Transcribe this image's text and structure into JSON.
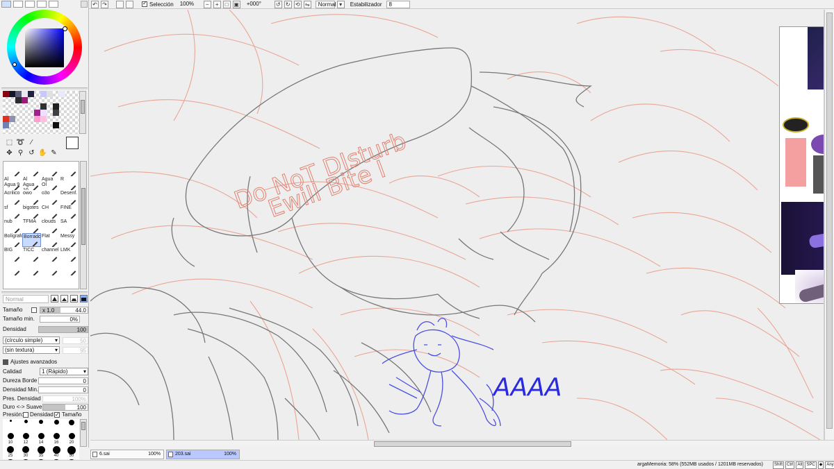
{
  "colors": {
    "accent": "#0000ff",
    "selection": "#c9dbff",
    "canvas_bg": "#eeeeee"
  },
  "toolbar": {
    "selection_label": "Selección",
    "zoom": "100%",
    "rotation": "+000°",
    "blend_mode": "Normal",
    "stabilizer_label": "Estabilizador",
    "stabilizer_value": "8"
  },
  "swatches": [
    "#8a0010",
    "#15152a",
    "#5c5c7a",
    "#e8e8f0",
    "#222240",
    "#ffffff",
    "#c8c8ff",
    "#e0e0e0",
    "#ffffff",
    "#e8e8ff",
    "#ffffff",
    "#ffffff",
    "#ffffff",
    "#ffffff",
    "#2a2a30",
    "#9e1a7a",
    "#ffffff",
    "#ffffff",
    "#ffffff",
    "#ffffff",
    "#ffffff",
    "#ffffff",
    "#ffffff",
    "#ffffff",
    "#ffffff",
    "#ffffff",
    "#ffffff",
    "#ffffff",
    "#ffffff",
    "#ffffff",
    "#303030",
    "#ffffff",
    "#202020",
    "#ffffff",
    "#ffffff",
    "#ffffff",
    "#ffffff",
    "#ffffff",
    "#ffffff",
    "#ffffff",
    "#ffffff",
    "#a02090",
    "#f0e0ff",
    "#ffffff",
    "#404040",
    "#ffffff",
    "#ffffff",
    "#ffffff",
    "#e03020",
    "#9090b0",
    "#ffffff",
    "#ffffff",
    "#ffffff",
    "#ffa0d0",
    "#ffc0e0",
    "#ffffff",
    "#ffffff",
    "#ffffff",
    "#ffffff",
    "#ffffff",
    "#7080b0",
    "#ffffff",
    "#ffffff",
    "#ffffff",
    "#ffffff",
    "#ffffff",
    "#ffffff",
    "#ffffff",
    "#101010",
    "#ffffff",
    "#ffffff",
    "#ffffff"
  ],
  "tools": [
    {
      "icon": "select-rect-icon",
      "glyph": "⬚"
    },
    {
      "icon": "lasso-icon",
      "glyph": "➰"
    },
    {
      "icon": "magic-wand-icon",
      "glyph": "⁄"
    },
    {
      "icon": "",
      "glyph": ""
    },
    {
      "icon": "",
      "glyph": ""
    },
    {
      "icon": "move-icon",
      "glyph": "✥"
    },
    {
      "icon": "zoom-icon",
      "glyph": "⚲"
    },
    {
      "icon": "rotate-icon",
      "glyph": "↺"
    },
    {
      "icon": "hand-icon",
      "glyph": "✋"
    },
    {
      "icon": "eyedropper-icon",
      "glyph": "✎"
    }
  ],
  "brushes": [
    {
      "label": "",
      "sel": false
    },
    {
      "label": "",
      "sel": false
    },
    {
      "label": "",
      "sel": false
    },
    {
      "label": "",
      "sel": false
    },
    {
      "label": "Al Agua 9",
      "sel": false
    },
    {
      "label": "Al Agua 10",
      "sel": false
    },
    {
      "label": "Agua Ol",
      "sel": false
    },
    {
      "label": "R",
      "sel": false
    },
    {
      "label": "Acrilico",
      "sel": false
    },
    {
      "label": "owo",
      "sel": false
    },
    {
      "label": "o3o",
      "sel": false
    },
    {
      "label": "Desenf.",
      "sel": false
    },
    {
      "label": "sf",
      "sel": false
    },
    {
      "label": "bigotes",
      "sel": false
    },
    {
      "label": "CH",
      "sel": false
    },
    {
      "label": "FINE",
      "sel": false
    },
    {
      "label": "nub",
      "sel": false
    },
    {
      "label": "TFMA",
      "sel": false
    },
    {
      "label": "clouds",
      "sel": false
    },
    {
      "label": "SA",
      "sel": false
    },
    {
      "label": "Bolígrafo",
      "sel": false
    },
    {
      "label": "Borrador",
      "sel": true
    },
    {
      "label": "Flat",
      "sel": false
    },
    {
      "label": "Messy",
      "sel": false
    },
    {
      "label": "BIG",
      "sel": false
    },
    {
      "label": "TICC",
      "sel": false
    },
    {
      "label": "channel",
      "sel": false
    },
    {
      "label": "LMK",
      "sel": false
    },
    {
      "label": "",
      "sel": false
    },
    {
      "label": "",
      "sel": false
    },
    {
      "label": "",
      "sel": false
    },
    {
      "label": "",
      "sel": false
    }
  ],
  "brush_props": {
    "blend": "Normal",
    "size_label": "Tamaño",
    "size_mult": "x 1.0",
    "size_value": "44.0",
    "min_size_label": "Tamaño min.",
    "min_size_value": "0%",
    "density_label": "Densidad",
    "density_value": "100",
    "shape": "(círculo simple)",
    "shape_value": "50",
    "texture": "(sin textura)",
    "texture_value": "95",
    "advanced_label": "Ajustes avanzados",
    "quality_label": "Calidad",
    "quality_value": "1 (Rápido)",
    "edge_label": "Dureza Borde",
    "edge_value": "0",
    "min_density_label": "Densidad Min.",
    "min_density_value": "0",
    "press_density_label": "Pres. Densidad !",
    "press_density_value": "100%",
    "hard_soft_label": "Duro <-> Suave",
    "hard_soft_value": "100",
    "pressure_label": "Presión:",
    "pressure_density": "Densidad",
    "pressure_size": "Tamaño"
  },
  "brush_sizes": [
    "",
    "",
    "",
    "",
    "",
    "10",
    "12",
    "14",
    "16",
    "20",
    "25",
    "30",
    "35",
    "40",
    "50",
    "",
    "",
    "",
    "",
    ""
  ],
  "canvas": {
    "bubble_line1": "Do NoT DIsturb",
    "bubble_line2": "Ewill Bite I",
    "scream": "AAAA"
  },
  "tabs": [
    {
      "name": "6.sai",
      "zoom": "100%"
    },
    {
      "name": "203.sai",
      "zoom": "100%"
    }
  ],
  "status": {
    "memory": "argaMemoria: 58% (552MB usados / 1201MB reservados)",
    "keys": [
      "Shift",
      "Ctrl",
      "Alt",
      "SPC",
      "◆",
      "Any",
      "✎"
    ]
  }
}
